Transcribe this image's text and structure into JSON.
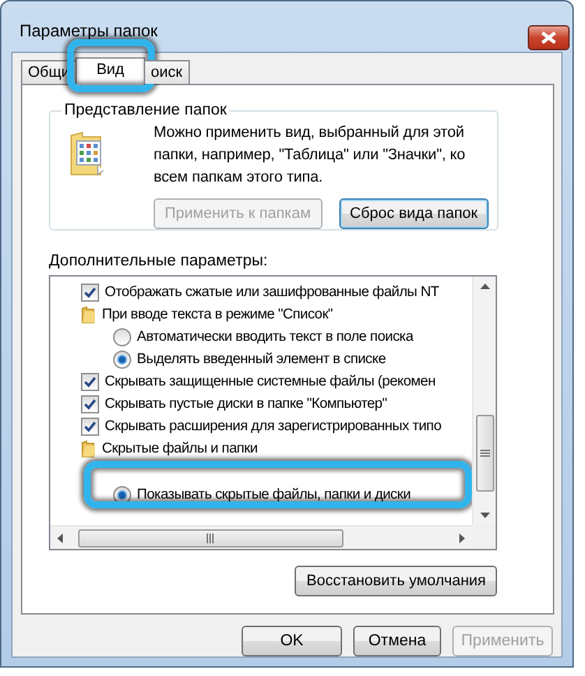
{
  "window": {
    "title": "Параметры папок"
  },
  "tabs": [
    {
      "label": "Общи",
      "selected": false,
      "highlighted": false
    },
    {
      "label": "Вид",
      "selected": true,
      "highlighted": true
    },
    {
      "label": "оиск",
      "selected": false,
      "highlighted": false
    }
  ],
  "folder_views": {
    "title": "Представление папок",
    "description": "Можно применить вид, выбранный для этой папки, например, \"Таблица\" или \"Значки\", ко всем папкам этого типа.",
    "buttons": [
      {
        "label": "Применить к папкам",
        "disabled": true,
        "focused": false
      },
      {
        "label": "Сброс вида папок",
        "disabled": false,
        "focused": true
      }
    ]
  },
  "advanced": {
    "title": "Дополнительные параметры:",
    "items": [
      {
        "kind": "checkbox",
        "label": "Отображать сжатые или зашифрованные файлы NT",
        "checked": true,
        "highlighted": false
      },
      {
        "kind": "folder",
        "label": "При вводе текста в режиме \"Список\"",
        "highlighted": false,
        "children": [
          {
            "kind": "radio",
            "label": "Автоматически вводить текст в поле поиска",
            "selected": false,
            "highlighted": false
          },
          {
            "kind": "radio",
            "label": "Выделять введенный элемент в списке",
            "selected": true,
            "highlighted": false
          }
        ]
      },
      {
        "kind": "checkbox",
        "label": "Скрывать защищенные системные файлы (рекомен",
        "checked": true,
        "highlighted": false
      },
      {
        "kind": "checkbox",
        "label": "Скрывать пустые диски в папке \"Компьютер\"",
        "checked": true,
        "highlighted": false
      },
      {
        "kind": "checkbox",
        "label": "Скрывать расширения для зарегистрированных типо",
        "checked": true,
        "highlighted": false
      },
      {
        "kind": "folder",
        "label": "Скрытые файлы и папки",
        "highlighted": false,
        "children": [
          {
            "kind": "radio",
            "label": "Показывать скрытые файлы, папки и диски",
            "selected": true,
            "highlighted": true
          }
        ]
      }
    ],
    "restore_button": "Восстановить умолчания"
  },
  "buttons": [
    {
      "label": "OK",
      "disabled": false
    },
    {
      "label": "Отмена",
      "disabled": false
    },
    {
      "label": "Применить",
      "disabled": true
    }
  ]
}
